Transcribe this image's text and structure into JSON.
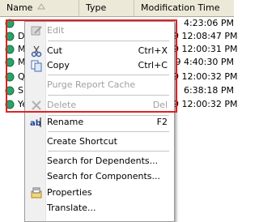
{
  "list": {
    "columns": [
      {
        "label": "Name"
      },
      {
        "label": "Type"
      },
      {
        "label": "Modification Time"
      }
    ],
    "rows": [
      {
        "name": "",
        "time": "4:23:06 PM"
      },
      {
        "name": "D",
        "time": "9 12:08:47 PM"
      },
      {
        "name": "M",
        "time": "9 12:00:31 PM"
      },
      {
        "name": "M",
        "time": "9 4:40:30 PM"
      },
      {
        "name": "Q",
        "time": "9 12:00:32 PM"
      },
      {
        "name": "Si",
        "time": "6:38:18 PM"
      },
      {
        "name": "Ye",
        "time": "9 12:00:32 PM"
      }
    ],
    "colors": {
      "accent_row_icon": "#2aa36b"
    }
  },
  "menu": {
    "items": [
      {
        "label": "Edit",
        "shortcut": "",
        "icon": "edit-icon",
        "disabled": true
      },
      {
        "label": "Cut",
        "shortcut": "Ctrl+X",
        "icon": "scissors-icon",
        "disabled": false
      },
      {
        "label": "Copy",
        "shortcut": "Ctrl+C",
        "icon": "copy-icon",
        "disabled": false
      },
      {
        "label": "Purge Report Cache",
        "shortcut": "",
        "icon": "",
        "disabled": true
      },
      {
        "label": "Delete",
        "shortcut": "Del",
        "icon": "delete-x-icon",
        "disabled": true
      },
      {
        "label": "Rename",
        "shortcut": "F2",
        "icon": "rename-icon",
        "disabled": false
      },
      {
        "label": "Create Shortcut",
        "shortcut": "",
        "icon": "",
        "disabled": false
      },
      {
        "label": "Search for Dependents...",
        "shortcut": "",
        "icon": "",
        "disabled": false
      },
      {
        "label": "Search for Components...",
        "shortcut": "",
        "icon": "",
        "disabled": false
      },
      {
        "label": "Properties",
        "shortcut": "",
        "icon": "properties-icon",
        "disabled": false
      },
      {
        "label": "Translate...",
        "shortcut": "",
        "icon": "",
        "disabled": false
      }
    ]
  }
}
